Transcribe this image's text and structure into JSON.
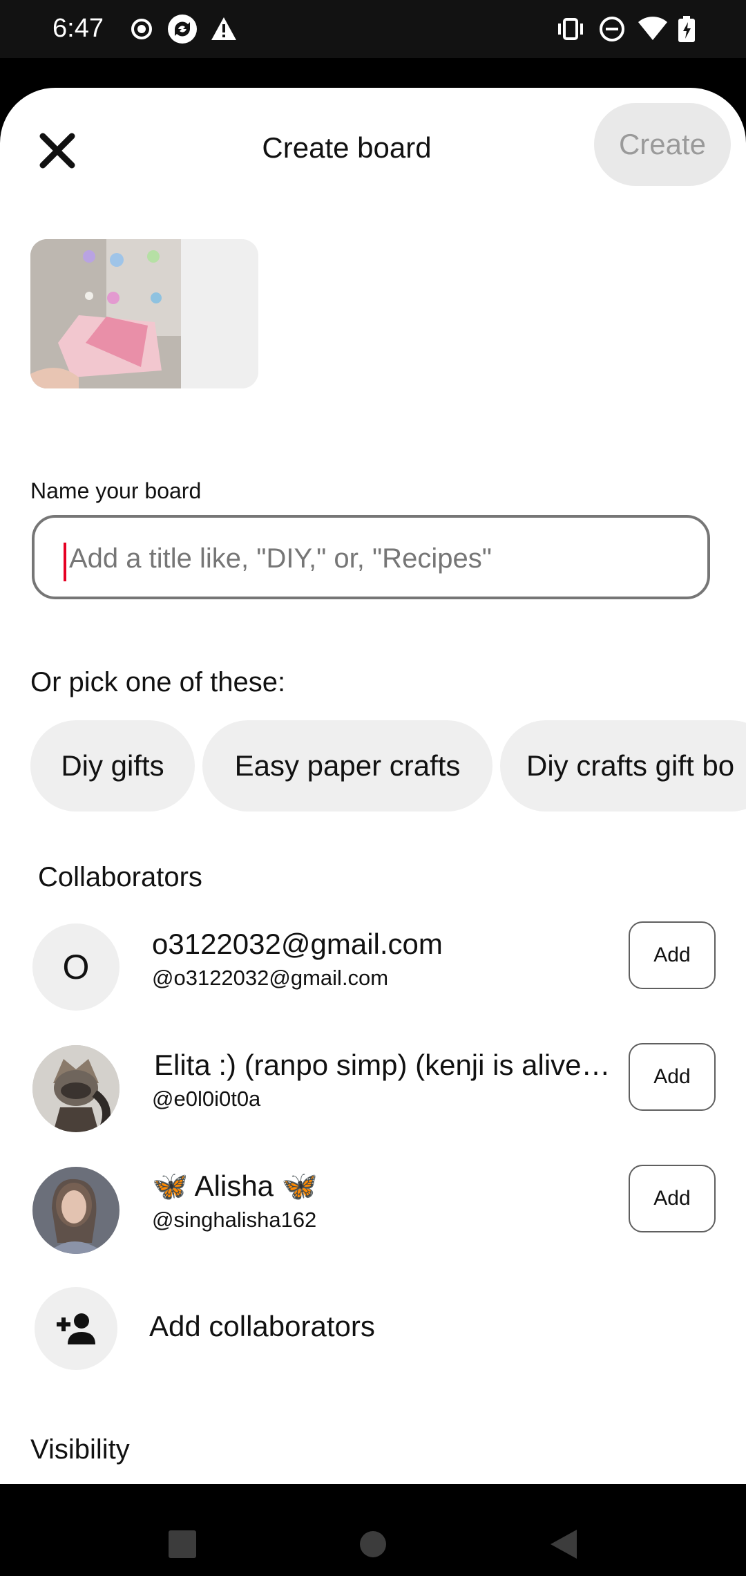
{
  "status_bar": {
    "time": "6:47",
    "left_icons": [
      "record-icon",
      "sync-icon",
      "warning-icon"
    ],
    "right_icons": [
      "vibrate-icon",
      "do-not-disturb-icon",
      "wifi-icon",
      "battery-icon"
    ]
  },
  "header": {
    "title": "Create board",
    "create_label": "Create",
    "close_icon": "close-icon"
  },
  "name_field": {
    "label": "Name your board",
    "placeholder": "Add a title like, \"DIY,\" or, \"Recipes\"",
    "value": ""
  },
  "suggestions": {
    "label": "Or pick one of these:",
    "chips": [
      "Diy gifts",
      "Easy paper crafts",
      "Diy crafts gift bo"
    ]
  },
  "collaborators": {
    "label": "Collaborators",
    "items": [
      {
        "avatar_letter": "O",
        "name": "o3122032@gmail.com",
        "username": "@o3122032@gmail.com",
        "button": "Add"
      },
      {
        "avatar_letter": "",
        "name": "Elita :) (ranpo simp) (kenji is alive…",
        "username": "@e0l0i0t0a",
        "button": "Add"
      },
      {
        "avatar_letter": "",
        "name": "🦋 Alisha 🦋",
        "username": "@singhalisha162",
        "button": "Add"
      }
    ],
    "add_label": "Add collaborators",
    "add_icon": "add-person-icon"
  },
  "visibility": {
    "label": "Visibility"
  },
  "nav_bar": {
    "icons": [
      "recents-icon",
      "home-icon",
      "back-icon"
    ]
  },
  "colors": {
    "accent": "#e60023",
    "chip_bg": "#efefef",
    "create_bg": "#e9e9e9",
    "create_text": "#9a9a9a"
  }
}
